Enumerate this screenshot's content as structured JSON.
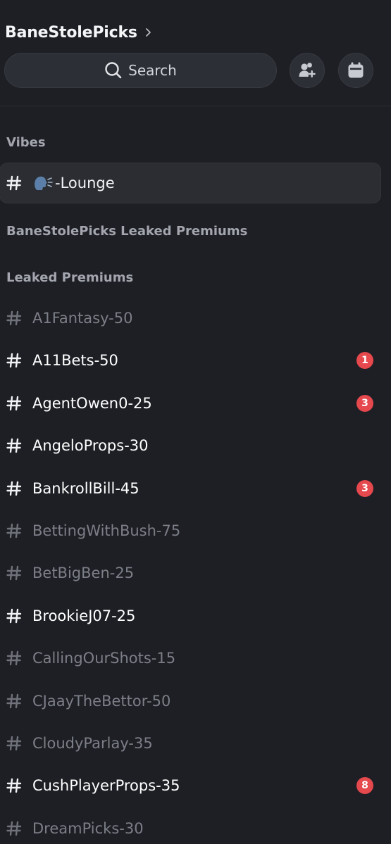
{
  "server": {
    "name": "BaneStolePicks"
  },
  "search": {
    "label": "Search"
  },
  "categories": {
    "vibes": "Vibes",
    "leaked_banner": "BaneStolePicks Leaked Premiums",
    "leaked": "Leaked Premiums"
  },
  "lounge": {
    "label": "-Lounge",
    "emoji": "speaking-head-icon"
  },
  "channels": [
    {
      "label": "A1Fantasy-50",
      "state": "muted",
      "badge": ""
    },
    {
      "label": "A11Bets-50",
      "state": "unread",
      "badge": "1"
    },
    {
      "label": "AgentOwen0-25",
      "state": "unread",
      "badge": "3"
    },
    {
      "label": "AngeloProps-30",
      "state": "unread",
      "badge": ""
    },
    {
      "label": "BankrollBill-45",
      "state": "unread",
      "badge": "3"
    },
    {
      "label": "BettingWithBush-75",
      "state": "muted",
      "badge": ""
    },
    {
      "label": "BetBigBen-25",
      "state": "muted",
      "badge": ""
    },
    {
      "label": "BrookieJ07-25",
      "state": "unread",
      "badge": ""
    },
    {
      "label": "CallingOurShots-15",
      "state": "muted",
      "badge": ""
    },
    {
      "label": "CJaayTheBettor-50",
      "state": "muted",
      "badge": ""
    },
    {
      "label": "CloudyParlay-35",
      "state": "muted",
      "badge": ""
    },
    {
      "label": "CushPlayerProps-35",
      "state": "unread",
      "badge": "8"
    },
    {
      "label": "DreamPicks-30",
      "state": "muted",
      "badge": ""
    }
  ],
  "colors": {
    "background": "#1e1f25",
    "badge": "#e5484d",
    "muted_text": "#7c7f88",
    "category_text": "#a3a6ae"
  }
}
